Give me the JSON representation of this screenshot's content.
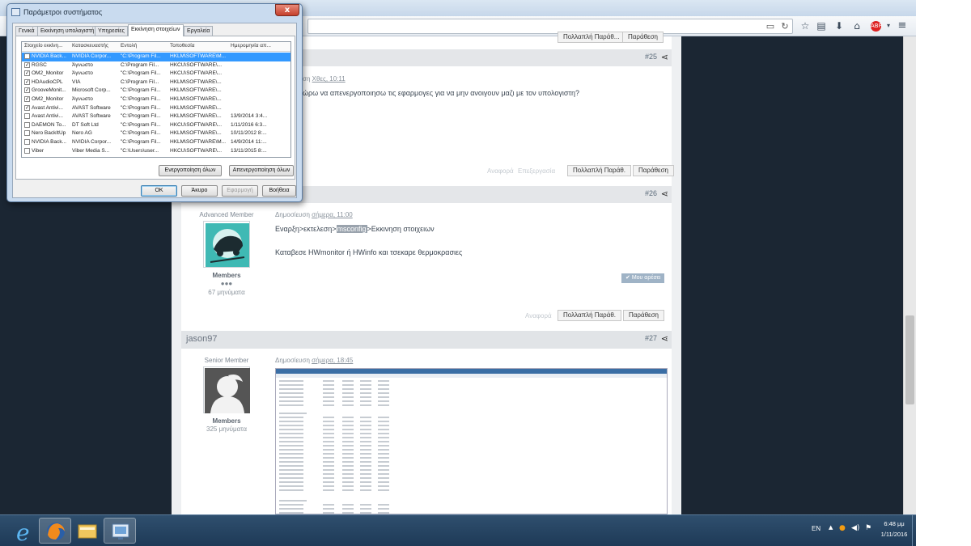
{
  "dialog": {
    "title": "Παράμετροι συστήματος",
    "close_label": "x",
    "tabs": [
      "Γενικά",
      "Εκκίνηση υπολογιστή",
      "Υπηρεσίες",
      "Εκκίνηση στοιχείων",
      "Εργαλεία"
    ],
    "active_tab": "Εκκίνηση στοιχείων",
    "columns": [
      "Στοιχείο εκκίνη...",
      "Κατασκευαστής",
      "Εντολή",
      "Τοποθεσία",
      "Ημερομηνία απ..."
    ],
    "rows": [
      {
        "checked": true,
        "item": "NVIDIA Back...",
        "maker": "NVIDIA Corpor...",
        "command": "\"C:\\Program Fil...",
        "location": "HKLM\\SOFTWARE\\M...",
        "date": "",
        "selected": true
      },
      {
        "checked": true,
        "item": "RGSC",
        "maker": "Άγνωστο",
        "command": "C:\\Program Fil...",
        "location": "HKCU\\SOFTWARE\\...",
        "date": ""
      },
      {
        "checked": true,
        "item": "OM2_Monitor",
        "maker": "Άγνωστο",
        "command": "\"C:\\Program Fil...",
        "location": "HKCU\\SOFTWARE\\...",
        "date": ""
      },
      {
        "checked": true,
        "item": "HDAudioCPL",
        "maker": "VIA",
        "command": "C:\\Program Fil...",
        "location": "HKLM\\SOFTWARE\\...",
        "date": ""
      },
      {
        "checked": true,
        "item": "GrooveMonit...",
        "maker": "Microsoft Corp...",
        "command": "\"C:\\Program Fil...",
        "location": "HKLM\\SOFTWARE\\...",
        "date": ""
      },
      {
        "checked": true,
        "item": "OM2_Monitor",
        "maker": "Άγνωστο",
        "command": "\"C:\\Program Fil...",
        "location": "HKLM\\SOFTWARE\\...",
        "date": ""
      },
      {
        "checked": true,
        "item": "Avast Antivi...",
        "maker": "AVAST Software",
        "command": "\"C:\\Program Fil...",
        "location": "HKLM\\SOFTWARE\\...",
        "date": ""
      },
      {
        "checked": false,
        "item": "Avast Antivi...",
        "maker": "AVAST Software",
        "command": "\"C:\\Program Fil...",
        "location": "HKLM\\SOFTWARE\\...",
        "date": "13/9/2014 3:4..."
      },
      {
        "checked": false,
        "item": "DAEMON To...",
        "maker": "DT Soft Ltd",
        "command": "\"C:\\Program Fil...",
        "location": "HKCU\\SOFTWARE\\...",
        "date": "1/11/2016 6:3..."
      },
      {
        "checked": false,
        "item": "Nero BackItUp",
        "maker": "Nero AG",
        "command": "\"C:\\Program Fil...",
        "location": "HKLM\\SOFTWARE\\...",
        "date": "10/11/2012 8:..."
      },
      {
        "checked": false,
        "item": "NVIDIA Back...",
        "maker": "NVIDIA Corpor...",
        "command": "\"C:\\Program Fil...",
        "location": "HKLM\\SOFTWARE\\M...",
        "date": "14/9/2014 11:..."
      },
      {
        "checked": false,
        "item": "Viber",
        "maker": "Viber Media S...",
        "command": "\"C:\\Users\\user...",
        "location": "HKCU\\SOFTWARE\\...",
        "date": "13/11/2015 8:..."
      }
    ],
    "enable_all": "Ενεργοποίηση όλων",
    "disable_all": "Απενεργοποίηση όλων",
    "ok": "OK",
    "cancel": "Άκυρο",
    "apply": "Εφαρμογή",
    "help": "Βοήθεια"
  },
  "browser": {
    "toolbar_icons": [
      "reader-icon",
      "reload-icon",
      "bookmark-star-icon",
      "bookmarks-list-icon",
      "download-icon",
      "home-icon",
      "adblock-icon",
      "menu-icon"
    ],
    "abp_label": "ABP"
  },
  "posts": {
    "top_buttons": {
      "quote_multi": "Πολλαπλή Παράθ...",
      "quote": "Παράθεση"
    },
    "post25": {
      "number": "#25",
      "posted": "ση",
      "posted_when": "Χθες, 10:11",
      "text": "ώρω να απενεργοποιησω τις εφαρμογες για να μην ανοιγουν μαζι με τον υπολογιστη?",
      "report": "Αναφορά",
      "edit": "Επεξεργασία",
      "quote_multi": "Πολλαπλή Παράθ.",
      "quote": "Παράθεση"
    },
    "post26": {
      "number": "#26",
      "rank": "Advanced Member",
      "posted_prefix": "Δημοσίευση ",
      "posted_when": "σήμερα, 11:00",
      "line1_a": "Εναρξη>εκτελεση>",
      "line1_hl": "msconfig",
      "line1_b": ">Εκκινηση στοιχειων",
      "line2": "Καταβεσε HWmonitor ή HWinfo και τσεκαρε θερμοκρασιες",
      "group": "Members",
      "pips": "●●●",
      "messages": "67 μηνύματα",
      "like": "Μου αρέσει",
      "report": "Αναφορά",
      "quote_multi": "Πολλαπλή Παράθ.",
      "quote": "Παράθεση"
    },
    "post27": {
      "number": "#27",
      "author": "jason97",
      "rank": "Senior Member",
      "posted_prefix": "Δημοσίευση ",
      "posted_when": "σήμερα, 18:45",
      "group": "Members",
      "messages": "325 μηνύματα"
    }
  },
  "taskbar": {
    "lang": "EN",
    "time": "6:48 μμ",
    "date": "1/11/2016",
    "apps": [
      "internet-explorer",
      "firefox",
      "file-explorer",
      "system-configuration"
    ]
  }
}
